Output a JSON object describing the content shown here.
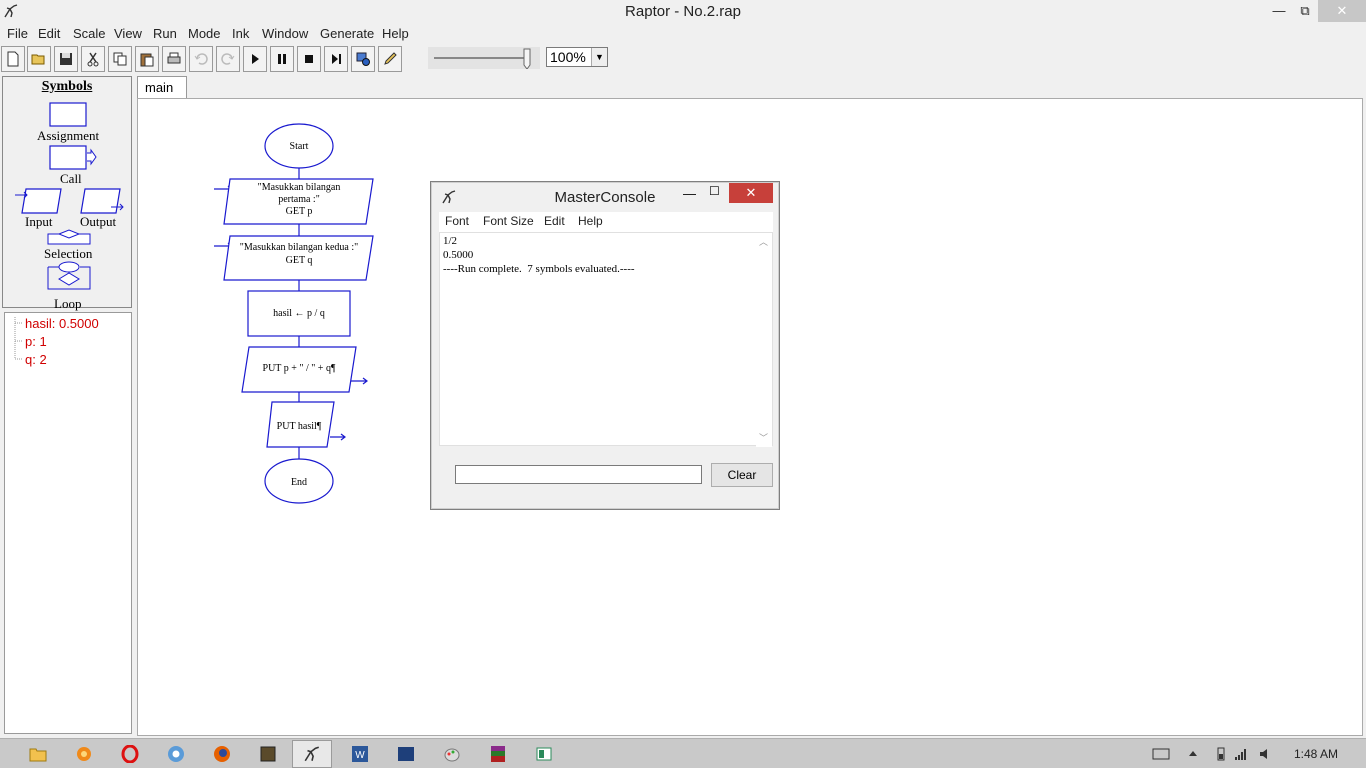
{
  "window": {
    "title": "Raptor - No.2.rap",
    "min": "—",
    "max": "⧉",
    "close": "✕"
  },
  "menu": [
    "File",
    "Edit",
    "Scale",
    "View",
    "Run",
    "Mode",
    "Ink",
    "Window",
    "Generate",
    "Help"
  ],
  "toolbar": {
    "icons": [
      "new-icon",
      "open-icon",
      "save-icon",
      "cut-icon",
      "copy-icon",
      "paste-icon",
      "print-icon",
      "undo-icon",
      "redo-icon",
      "play-icon",
      "pause-icon",
      "stop-icon",
      "step-icon",
      "test-icon",
      "pen-icon"
    ],
    "zoom": "100%",
    "speed_fraction": 1.0
  },
  "symbols": {
    "title": "Symbols",
    "assignment": "Assignment",
    "call": "Call",
    "input": "Input",
    "output": "Output",
    "selection": "Selection",
    "loop": "Loop"
  },
  "variables": [
    "hasil: 0.5000",
    "p: 1",
    "q: 2"
  ],
  "tab": "main",
  "flowchart": {
    "start": "Start",
    "input1_line1": "\"Masukkan bilangan",
    "input1_line2": "pertama :\"",
    "input1_line3": "GET p",
    "input2_line1": "\"Masukkan bilangan kedua :\"",
    "input2_line2": "GET q",
    "assign": "hasil ← p / q",
    "output1": "PUT p + \" / \" + q¶",
    "output2": "PUT hasil¶",
    "end": "End"
  },
  "console": {
    "title": "MasterConsole",
    "menu": [
      "Font",
      "Font Size",
      "Edit",
      "Help"
    ],
    "lines": [
      "1/2",
      "0.5000",
      "----Run complete.  7 symbols evaluated.----"
    ],
    "input_value": "",
    "clear": "Clear"
  },
  "taskbar": {
    "apps": [
      "file-explorer-icon",
      "firefox-orange-icon",
      "opera-icon",
      "chrome-icon",
      "firefox-icon",
      "app-icon",
      "raptor-icon",
      "word-icon",
      "app2-icon",
      "paint-icon",
      "winrar-icon",
      "app3-icon"
    ],
    "clock": "1:48 AM"
  },
  "colors": {
    "flowchart_stroke": "#1a1acf",
    "variable_text": "#d00000",
    "close_red": "#c7403a"
  }
}
